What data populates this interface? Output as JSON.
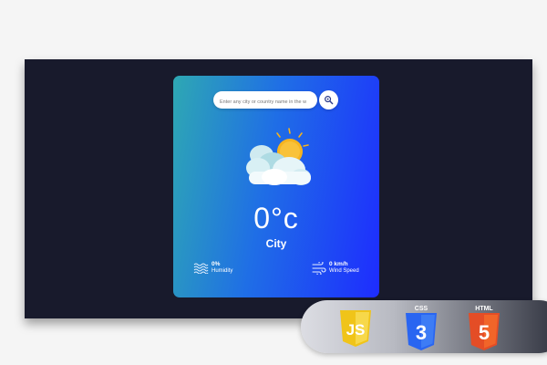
{
  "search": {
    "placeholder": "Enter any city or country name in the w"
  },
  "weather": {
    "temperature": "0°c",
    "city": "City",
    "icon": "sun-behind-clouds-icon"
  },
  "stats": {
    "humidity_value": "0%",
    "humidity_label": "Humidity",
    "wind_value": "0 km/h",
    "wind_label": "Wind Speed"
  },
  "badges": {
    "js_text": "JS",
    "css_label": "CSS",
    "css_number": "3",
    "html_label": "HTML",
    "html_number": "5"
  },
  "colors": {
    "background": "#181a2c",
    "card_gradient_start": "#2ea8b3",
    "card_gradient_end": "#1e2cff",
    "js_yellow": "#f0c419",
    "css_blue": "#2965f1",
    "html_orange": "#e44d26"
  }
}
